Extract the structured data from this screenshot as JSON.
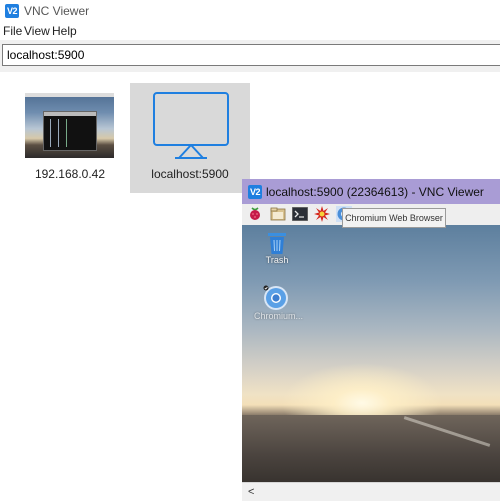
{
  "window": {
    "title": "VNC Viewer",
    "logo_text": "V2",
    "menu": [
      "File",
      "View",
      "Help"
    ]
  },
  "address_bar": {
    "value": "localhost:5900"
  },
  "connections": [
    {
      "label": "192.168.0.42"
    },
    {
      "label": "localhost:5900",
      "selected": true
    }
  ],
  "session_window": {
    "title": "localhost:5900 (22364613) - VNC Viewer",
    "logo_text": "V2",
    "taskbar_icons": [
      "raspberry-menu-icon",
      "file-manager-icon",
      "terminal-icon",
      "burst-icon",
      "chromium-icon"
    ],
    "tooltip": "Chromium Web Browser",
    "desktop_items": [
      {
        "label": "Trash",
        "icon": "trash-icon"
      },
      {
        "label": "Chromium...",
        "icon": "chromium-icon"
      }
    ],
    "scroll_left_glyph": "<"
  },
  "colors": {
    "accent_blue": "#1f7fe0",
    "session_titlebar": "#a99cd5",
    "selected_tile": "#d9d9d9"
  }
}
